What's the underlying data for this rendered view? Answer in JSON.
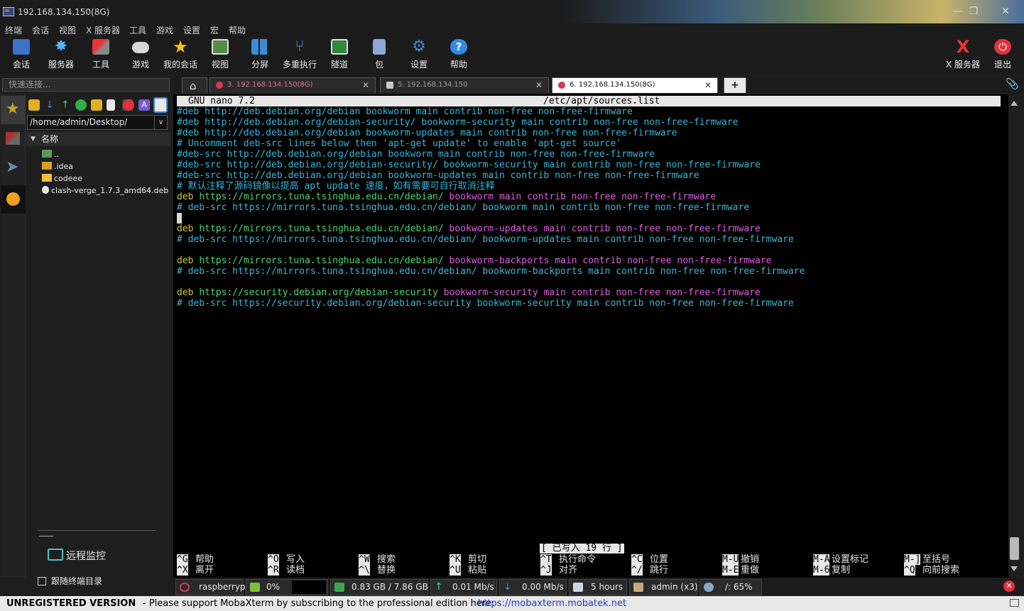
{
  "window": {
    "title": "192.168.134.150(8G)"
  },
  "menu": [
    "终端",
    "会话",
    "视图",
    "X 服务器",
    "工具",
    "游戏",
    "设置",
    "宏",
    "帮助"
  ],
  "toolbar": {
    "items": [
      "会话",
      "服务器",
      "工具",
      "游戏",
      "我的会话",
      "视图",
      "分屏",
      "多重执行",
      "隧道",
      "包",
      "设置",
      "帮助"
    ],
    "xserver": "X 服务器",
    "exit": "退出"
  },
  "quick_connect": {
    "placeholder": "快速连接..."
  },
  "tabs": [
    {
      "label": "3. 192.168.134.150(8G)",
      "active": false
    },
    {
      "label": "5. 192.168.134.150",
      "active": false
    },
    {
      "label": "6. 192.168.134.150(8G)",
      "active": true
    }
  ],
  "sftp": {
    "path": "/home/admin/Desktop/",
    "column_name": "名称",
    "files": [
      "..",
      ".idea",
      "codeee",
      "clash-verge_1.7.3_amd64.deb"
    ],
    "remote_monitor": "远程监控",
    "follow_terminal": "跟随终端目录"
  },
  "nano": {
    "version": "GNU nano 7.2",
    "filename": "/etc/apt/sources.list",
    "lines": [
      {
        "parts": [
          {
            "t": "#deb http://deb.debian.org/debian bookworm main contrib non-free non-free-firmware",
            "c": "cyan"
          }
        ]
      },
      {
        "parts": [
          {
            "t": "#deb http://deb.debian.org/debian-security/ bookworm-security main contrib non-free non-free-firmware",
            "c": "cyan"
          }
        ]
      },
      {
        "parts": [
          {
            "t": "#deb http://deb.debian.org/debian bookworm-updates main contrib non-free non-free-firmware",
            "c": "cyan"
          }
        ]
      },
      {
        "parts": [
          {
            "t": "# Uncomment deb-src lines below then 'apt-get update' to enable 'apt-get source'",
            "c": "cyan"
          }
        ]
      },
      {
        "parts": [
          {
            "t": "#deb-src http://deb.debian.org/debian bookworm main contrib non-free non-free-firmware",
            "c": "cyan"
          }
        ]
      },
      {
        "parts": [
          {
            "t": "#deb-src http://deb.debian.org/debian-security/ bookworm-security main contrib non-free non-free-firmware",
            "c": "cyan"
          }
        ]
      },
      {
        "parts": [
          {
            "t": "#deb-src http://deb.debian.org/debian bookworm-updates main contrib non-free non-free-firmware",
            "c": "cyan"
          }
        ]
      },
      {
        "parts": [
          {
            "t": "# 默认注释了源码镜像以提高 apt update 速度，如有需要可自行取消注释",
            "c": "cyan"
          }
        ]
      },
      {
        "parts": [
          {
            "t": "deb ",
            "c": "yellow"
          },
          {
            "t": "https://mirrors.tuna.tsinghua.edu.cn/debian/ ",
            "c": "green"
          },
          {
            "t": "bookworm main contrib non-free non-free-firmware",
            "c": "mag"
          }
        ]
      },
      {
        "parts": [
          {
            "t": "# deb-src https://mirrors.tuna.tsinghua.edu.cn/debian/ bookworm main contrib non-free non-free-firmware",
            "c": "cyan"
          }
        ]
      },
      {
        "parts": []
      },
      {
        "parts": [
          {
            "t": "deb ",
            "c": "yellow"
          },
          {
            "t": "https://mirrors.tuna.tsinghua.edu.cn/debian/ ",
            "c": "green"
          },
          {
            "t": "bookworm-updates main contrib non-free non-free-firmware",
            "c": "mag"
          }
        ]
      },
      {
        "parts": [
          {
            "t": "# deb-src https://mirrors.tuna.tsinghua.edu.cn/debian/ bookworm-updates main contrib non-free non-free-firmware",
            "c": "cyan"
          }
        ]
      },
      {
        "parts": []
      },
      {
        "parts": [
          {
            "t": "deb ",
            "c": "yellow"
          },
          {
            "t": "https://mirrors.tuna.tsinghua.edu.cn/debian/ ",
            "c": "green"
          },
          {
            "t": "bookworm-backports main contrib non-free non-free-firmware",
            "c": "mag"
          }
        ]
      },
      {
        "parts": [
          {
            "t": "# deb-src https://mirrors.tuna.tsinghua.edu.cn/debian/ bookworm-backports main contrib non-free non-free-firmware",
            "c": "cyan"
          }
        ]
      },
      {
        "parts": []
      },
      {
        "parts": [
          {
            "t": "deb ",
            "c": "yellow"
          },
          {
            "t": "https://security.debian.org/debian-security ",
            "c": "green"
          },
          {
            "t": "bookworm-security main contrib non-free non-free-firmware",
            "c": "mag"
          }
        ]
      },
      {
        "parts": [
          {
            "t": "# deb-src https://security.debian.org/debian-security bookworm-security main contrib non-free non-free-firmware",
            "c": "cyan"
          }
        ]
      }
    ],
    "status_message": "[ 已写入 19 行 ]",
    "help": [
      {
        "k1": "^G",
        "d1": "帮助",
        "k2": "^X",
        "d2": "离开"
      },
      {
        "k1": "^O",
        "d1": "写入",
        "k2": "^R",
        "d2": "读档"
      },
      {
        "k1": "^W",
        "d1": "搜索",
        "k2": "^\\",
        "d2": "替换"
      },
      {
        "k1": "^K",
        "d1": "剪切",
        "k2": "^U",
        "d2": "粘贴"
      },
      {
        "k1": "^T",
        "d1": "执行命令",
        "k2": "^J",
        "d2": "对齐"
      },
      {
        "k1": "^C",
        "d1": "位置",
        "k2": "^/",
        "d2": "跳行"
      },
      {
        "k1": "M-U",
        "d1": "撤销",
        "k2": "M-E",
        "d2": "重做"
      },
      {
        "k1": "M-A",
        "d1": "设置标记",
        "k2": "M-6",
        "d2": "复制"
      },
      {
        "k1": "M-]",
        "d1": "至括号",
        "k2": "^Q",
        "d2": "向前搜索"
      }
    ]
  },
  "statusbar": {
    "host": "raspberrypi",
    "cpu": "0%",
    "memory": "0.83 GB / 7.86 GB",
    "upload": "0.01 Mb/s",
    "download": "0.00 Mb/s",
    "uptime": "5 hours",
    "user": "admin (x3)",
    "disk": "/: 65%"
  },
  "footer": {
    "unregistered": "UNREGISTERED VERSION",
    "message": "-  Please support MobaXterm by subscribing to the professional edition here:",
    "link": "https://mobaxterm.mobatek.net"
  },
  "colors": {
    "cyan": "#36b7d6",
    "yellow": "#d6c83a",
    "green": "#4fd66a",
    "magenta": "#e05ee0",
    "close_red": "#e0323c"
  }
}
